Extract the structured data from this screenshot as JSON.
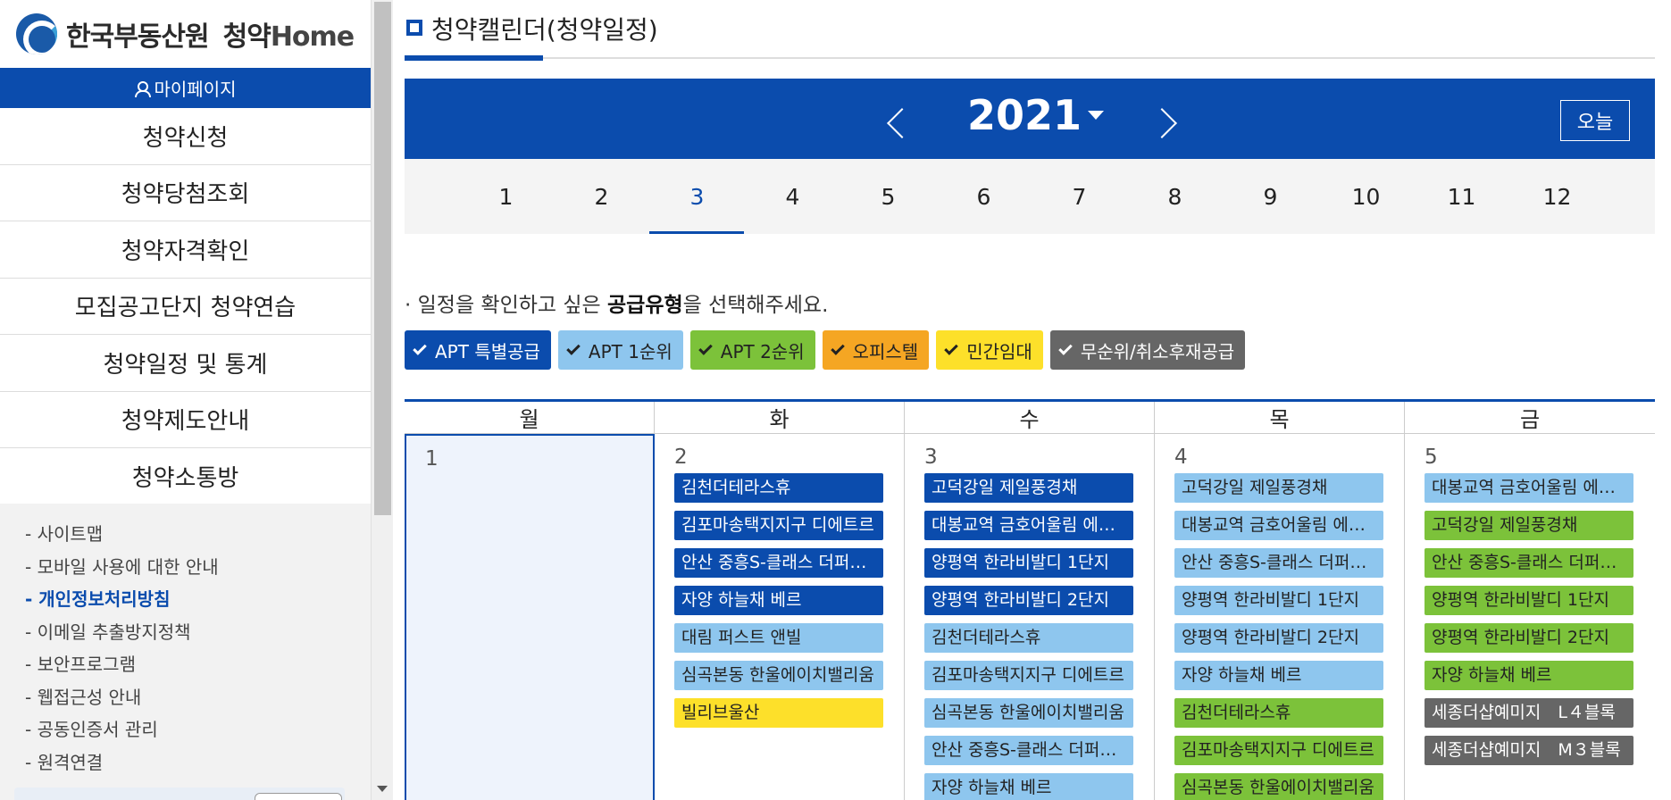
{
  "sidebar": {
    "logo_text": "한국부동산원",
    "logo_sub": "청약",
    "logo_home": "Home",
    "mypage_label": "마이페이지",
    "menu": [
      "청약신청",
      "청약당첨조회",
      "청약자격확인",
      "모집공고단지 청약연습",
      "청약일정 및 통계",
      "청약제도안내",
      "청약소통방"
    ],
    "links": [
      {
        "label": "- 사이트맵",
        "active": false
      },
      {
        "label": "- 모바일 사용에 대한 안내",
        "active": false
      },
      {
        "label": "- 개인정보처리방침",
        "active": true
      },
      {
        "label": "- 이메일 추출방지정책",
        "active": false
      },
      {
        "label": "- 보안프로그램",
        "active": false
      },
      {
        "label": "- 웹접근성 안내",
        "active": false
      },
      {
        "label": "- 공동인증서 관리",
        "active": false
      },
      {
        "label": "- 원격연결",
        "active": false
      }
    ]
  },
  "main": {
    "title": "청약캘린더(청약일정)",
    "year": "2021",
    "today_label": "오늘",
    "months": [
      "1",
      "2",
      "3",
      "4",
      "5",
      "6",
      "7",
      "8",
      "9",
      "10",
      "11",
      "12"
    ],
    "active_month": "3",
    "instruction_pre": "· 일정을 확인하고 싶은 ",
    "instruction_bold": "공급유형",
    "instruction_post": "을 선택해주세요.",
    "filters": [
      {
        "label": "APT 특별공급",
        "type": "t-sp",
        "color": "#0b4cad"
      },
      {
        "label": "APT 1순위",
        "type": "t-1",
        "color": "#8ec6ee"
      },
      {
        "label": "APT 2순위",
        "type": "t-2",
        "color": "#7cc23a"
      },
      {
        "label": "오피스텔",
        "type": "t-of",
        "color": "#f5a623"
      },
      {
        "label": "민간임대",
        "type": "t-pr",
        "color": "#fde02a"
      },
      {
        "label": "무순위/취소후재공급",
        "type": "t-ns",
        "color": "#666666"
      }
    ],
    "weekdays": [
      "월",
      "화",
      "수",
      "목",
      "금"
    ],
    "days": [
      {
        "num": "1",
        "selected": true,
        "events": []
      },
      {
        "num": "2",
        "selected": false,
        "events": [
          {
            "label": "김천더테라스휴",
            "type": "t-sp"
          },
          {
            "label": "김포마송택지지구 디에트르",
            "type": "t-sp"
          },
          {
            "label": "안산 중흥S-클래스 더퍼스트",
            "type": "t-sp"
          },
          {
            "label": "자양 하늘채 베르",
            "type": "t-sp"
          },
          {
            "label": "대림 퍼스트 앤빌",
            "type": "t-1"
          },
          {
            "label": "심곡본동 한울에이치밸리움",
            "type": "t-1"
          },
          {
            "label": "빌리브울산",
            "type": "t-pr"
          }
        ]
      },
      {
        "num": "3",
        "selected": false,
        "events": [
          {
            "label": "고덕강일 제일풍경채",
            "type": "t-sp"
          },
          {
            "label": "대봉교역 금호어울림 에듀포레",
            "type": "t-sp"
          },
          {
            "label": "양평역 한라비발디 1단지",
            "type": "t-sp"
          },
          {
            "label": "양평역 한라비발디 2단지",
            "type": "t-sp"
          },
          {
            "label": "김천더테라스휴",
            "type": "t-1"
          },
          {
            "label": "김포마송택지지구 디에트르",
            "type": "t-1"
          },
          {
            "label": "심곡본동 한울에이치밸리움",
            "type": "t-1"
          },
          {
            "label": "안산 중흥S-클래스 더퍼스트",
            "type": "t-1"
          },
          {
            "label": "자양 하늘채 베르",
            "type": "t-1"
          }
        ]
      },
      {
        "num": "4",
        "selected": false,
        "events": [
          {
            "label": "고덕강일 제일풍경채",
            "type": "t-1"
          },
          {
            "label": "대봉교역 금호어울림 에듀포레",
            "type": "t-1"
          },
          {
            "label": "안산 중흥S-클래스 더퍼스트",
            "type": "t-1"
          },
          {
            "label": "양평역 한라비발디 1단지",
            "type": "t-1"
          },
          {
            "label": "양평역 한라비발디 2단지",
            "type": "t-1"
          },
          {
            "label": "자양 하늘채 베르",
            "type": "t-1"
          },
          {
            "label": "김천더테라스휴",
            "type": "t-2"
          },
          {
            "label": "김포마송택지지구 디에트르",
            "type": "t-2"
          },
          {
            "label": "심곡본동 한울에이치밸리움",
            "type": "t-2"
          }
        ]
      },
      {
        "num": "5",
        "selected": false,
        "events": [
          {
            "label": "대봉교역 금호어울림 에듀포레",
            "type": "t-1"
          },
          {
            "label": "고덕강일 제일풍경채",
            "type": "t-2"
          },
          {
            "label": "안산 중흥S-클래스 더퍼스트",
            "type": "t-2"
          },
          {
            "label": "양평역 한라비발디 1단지",
            "type": "t-2"
          },
          {
            "label": "양평역 한라비발디 2단지",
            "type": "t-2"
          },
          {
            "label": "자양 하늘채 베르",
            "type": "t-2"
          },
          {
            "label": "세종더샵예미지　L４블록",
            "type": "t-ns"
          },
          {
            "label": "세종더샵예미지　M３블록",
            "type": "t-ns"
          }
        ]
      }
    ]
  }
}
